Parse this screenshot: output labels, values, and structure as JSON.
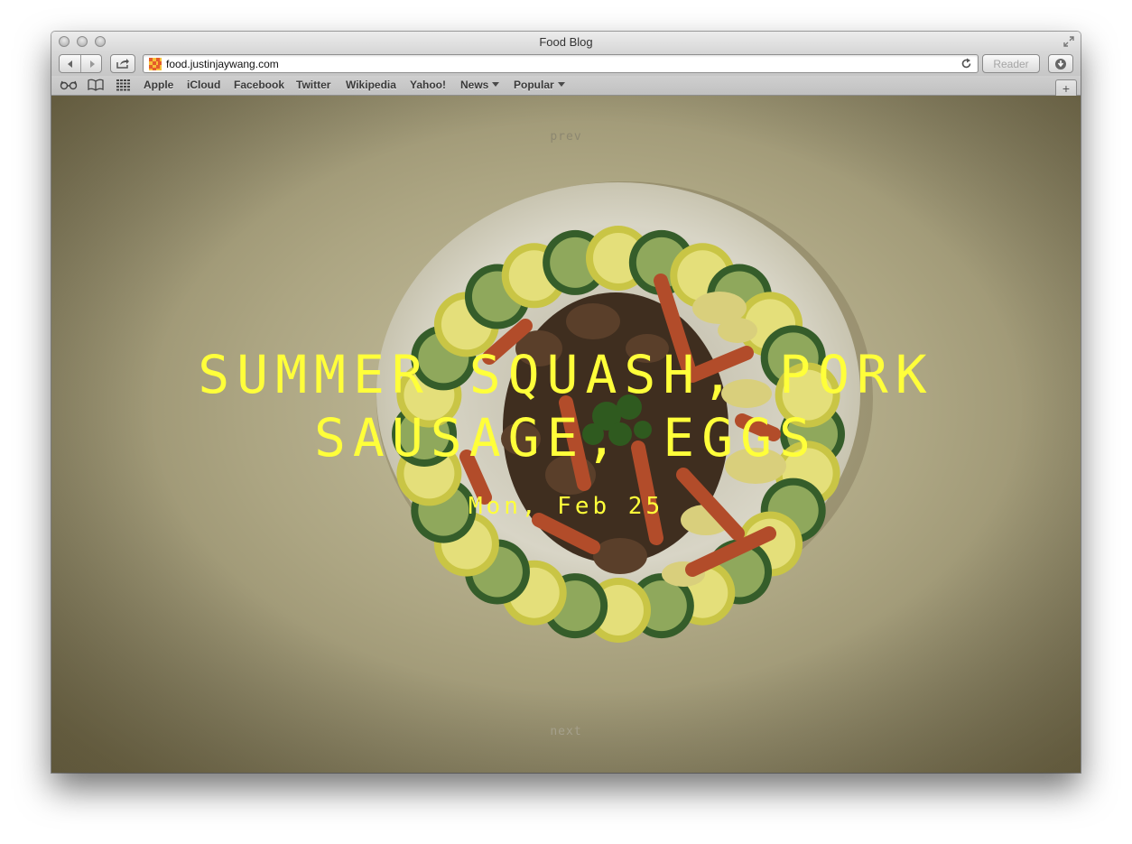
{
  "window": {
    "title": "Food Blog"
  },
  "toolbar": {
    "url": "food.justinjaywang.com",
    "reader_label": "Reader"
  },
  "bookmarks": {
    "items": [
      {
        "label": "Apple"
      },
      {
        "label": "iCloud"
      },
      {
        "label": "Facebook"
      },
      {
        "label": "Twitter"
      },
      {
        "label": "Wikipedia"
      },
      {
        "label": "Yahoo!"
      },
      {
        "label": "News",
        "dropdown": true
      },
      {
        "label": "Popular",
        "dropdown": true
      }
    ],
    "icons": [
      "reading-list-icon",
      "bookmarks-book-icon",
      "top-sites-grid-icon"
    ]
  },
  "page": {
    "prev_label": "prev",
    "next_label": "next",
    "post_title": "SUMMER SQUASH, PORK SAUSAGE, EGGS",
    "post_date": "Mon, Feb 25"
  },
  "colors": {
    "title_yellow": "#ffff3a",
    "nav_link_gray": "#8e8a74",
    "plate_white": "#d6d3c4",
    "zucchini_green": "#355d2a",
    "squash_yellow": "#c9c545",
    "carrot_orange": "#b24c2a"
  }
}
